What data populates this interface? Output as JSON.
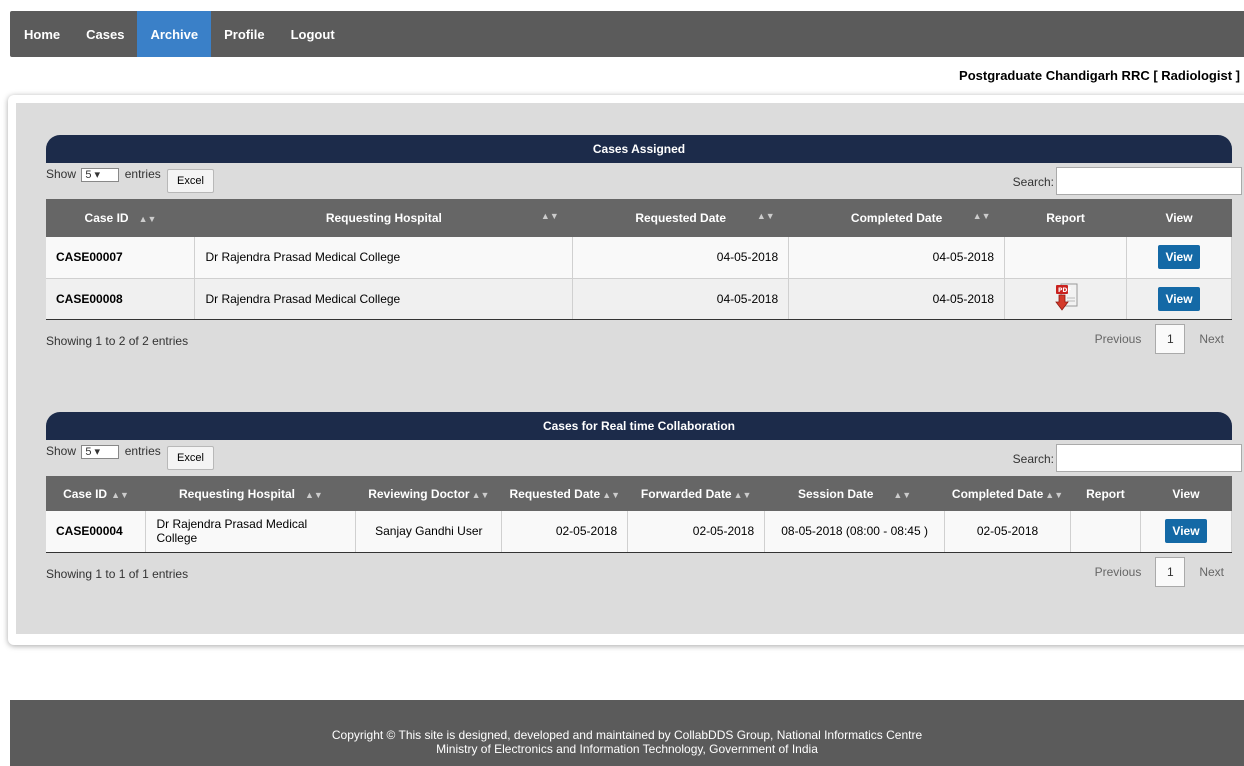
{
  "nav": {
    "items": [
      "Home",
      "Cases",
      "Archive",
      "Profile",
      "Logout"
    ],
    "active": "Archive"
  },
  "user_line": "Postgraduate Chandigarh RRC [ Radiologist ]",
  "common": {
    "show_label": "Show",
    "entries_label": "entries",
    "entries_value": "5",
    "excel_label": "Excel",
    "search_label": "Search:",
    "previous_label": "Previous",
    "next_label": "Next",
    "page": "1",
    "view_label": "View"
  },
  "assigned": {
    "title": "Cases Assigned",
    "headers": [
      "Case ID",
      "Requesting Hospital",
      "Requested Date",
      "Completed Date",
      "Report",
      "View"
    ],
    "rows": [
      {
        "case_id": "CASE00007",
        "hospital": "Dr Rajendra Prasad Medical College",
        "requested": "04-05-2018",
        "completed": "04-05-2018",
        "report_icon": "none"
      },
      {
        "case_id": "CASE00008",
        "hospital": "Dr Rajendra Prasad Medical College",
        "requested": "04-05-2018",
        "completed": "04-05-2018",
        "report_icon": "pdf-download-icon"
      }
    ],
    "showing": "Showing 1 to 2 of 2 entries"
  },
  "collab": {
    "title": "Cases for Real time Collaboration",
    "headers": [
      "Case ID",
      "Requesting Hospital",
      "Reviewing Doctor",
      "Requested Date",
      "Forwarded Date",
      "Session Date",
      "Completed Date",
      "Report",
      "View"
    ],
    "rows": [
      {
        "case_id": "CASE00004",
        "hospital": "Dr Rajendra Prasad Medical College",
        "doctor": "Sanjay Gandhi User",
        "requested": "02-05-2018",
        "forwarded": "02-05-2018",
        "session": "08-05-2018 (08:00 - 08:45 )",
        "completed": "02-05-2018"
      }
    ],
    "showing": "Showing 1 to 1 of 1 entries"
  },
  "footer": {
    "line1": "Copyright © This site is designed, developed and maintained by CollabDDS Group, National Informatics Centre",
    "line2": "Ministry of Electronics and Information Technology, Government of India"
  },
  "colors": {
    "nav_bg": "#5b5b5b",
    "nav_active": "#3a80c8",
    "section_title_bg": "#1c2b4a",
    "header_bg": "#666666",
    "view_button": "#1469a6"
  }
}
